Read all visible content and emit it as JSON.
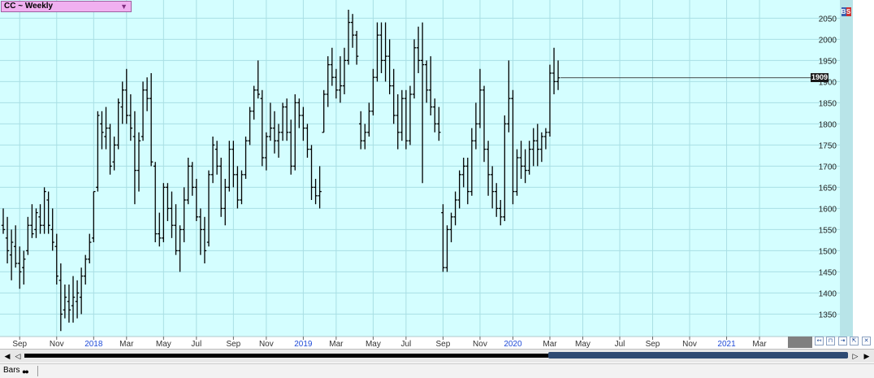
{
  "window": {
    "symbol_label": "CC ~ Weekly",
    "bs_b": "B",
    "bs_s": "S",
    "last_price": "1909",
    "status_label": "Bars"
  },
  "colors": {
    "plot_bg": "#d4feff",
    "grid": "#a9dfe4",
    "bars": "#000000",
    "year_label": "#1f4bd8",
    "month_label": "#333333",
    "price_strip": "#b8e4e8"
  },
  "chart_data": {
    "type": "ohlc",
    "title": "CC ~ Weekly",
    "y_ticks": [
      1350,
      1400,
      1450,
      1500,
      1550,
      1600,
      1650,
      1700,
      1750,
      1800,
      1850,
      1900,
      1950,
      2000,
      2050
    ],
    "ylim": [
      1297,
      2093
    ],
    "grid": true,
    "x_labels": [
      {
        "text": "Sep",
        "year": false,
        "bar": 4
      },
      {
        "text": "Nov",
        "year": false,
        "bar": 13
      },
      {
        "text": "2018",
        "year": true,
        "bar": 22
      },
      {
        "text": "Mar",
        "year": false,
        "bar": 30
      },
      {
        "text": "May",
        "year": false,
        "bar": 39
      },
      {
        "text": "Jul",
        "year": false,
        "bar": 47
      },
      {
        "text": "Sep",
        "year": false,
        "bar": 56
      },
      {
        "text": "Nov",
        "year": false,
        "bar": 64
      },
      {
        "text": "2019",
        "year": true,
        "bar": 73
      },
      {
        "text": "Mar",
        "year": false,
        "bar": 81
      },
      {
        "text": "May",
        "year": false,
        "bar": 90
      },
      {
        "text": "Jul",
        "year": false,
        "bar": 98
      },
      {
        "text": "Sep",
        "year": false,
        "bar": 107
      },
      {
        "text": "Nov",
        "year": false,
        "bar": 116
      },
      {
        "text": "2020",
        "year": true,
        "bar": 124
      },
      {
        "text": "Mar",
        "year": false,
        "bar": 133
      },
      {
        "text": "May",
        "year": false,
        "bar": 141
      },
      {
        "text": "Jul",
        "year": false,
        "bar": 150
      },
      {
        "text": "Sep",
        "year": false,
        "bar": 158
      },
      {
        "text": "Nov",
        "year": false,
        "bar": 167
      },
      {
        "text": "2021",
        "year": true,
        "bar": 176
      },
      {
        "text": "Mar",
        "year": false,
        "bar": 184
      }
    ],
    "bars": [
      [
        1560,
        1600,
        1540,
        1550
      ],
      [
        1530,
        1580,
        1470,
        1500
      ],
      [
        1490,
        1550,
        1430,
        1520
      ],
      [
        1510,
        1560,
        1460,
        1470
      ],
      [
        1470,
        1510,
        1410,
        1450
      ],
      [
        1460,
        1500,
        1420,
        1480
      ],
      [
        1500,
        1580,
        1490,
        1560
      ],
      [
        1560,
        1610,
        1530,
        1540
      ],
      [
        1550,
        1600,
        1530,
        1590
      ],
      [
        1580,
        1610,
        1540,
        1560
      ],
      [
        1560,
        1650,
        1540,
        1640
      ],
      [
        1620,
        1640,
        1540,
        1560
      ],
      [
        1550,
        1600,
        1500,
        1520
      ],
      [
        1510,
        1540,
        1420,
        1440
      ],
      [
        1430,
        1470,
        1310,
        1350
      ],
      [
        1360,
        1420,
        1340,
        1390
      ],
      [
        1380,
        1420,
        1330,
        1360
      ],
      [
        1370,
        1440,
        1330,
        1390
      ],
      [
        1380,
        1430,
        1340,
        1400
      ],
      [
        1390,
        1460,
        1350,
        1440
      ],
      [
        1440,
        1490,
        1420,
        1480
      ],
      [
        1480,
        1540,
        1470,
        1520
      ],
      [
        1530,
        1640,
        1520,
        1640
      ],
      [
        1650,
        1830,
        1640,
        1820
      ],
      [
        1800,
        1830,
        1740,
        1780
      ],
      [
        1770,
        1840,
        1740,
        1790
      ],
      [
        1790,
        1800,
        1680,
        1700
      ],
      [
        1710,
        1770,
        1690,
        1750
      ],
      [
        1750,
        1860,
        1740,
        1850
      ],
      [
        1840,
        1900,
        1800,
        1880
      ],
      [
        1880,
        1930,
        1800,
        1820
      ],
      [
        1820,
        1870,
        1760,
        1790
      ],
      [
        1770,
        1830,
        1610,
        1690
      ],
      [
        1690,
        1780,
        1640,
        1760
      ],
      [
        1770,
        1900,
        1760,
        1880
      ],
      [
        1880,
        1910,
        1830,
        1860
      ],
      [
        1860,
        1920,
        1700,
        1710
      ],
      [
        1700,
        1710,
        1520,
        1540
      ],
      [
        1540,
        1590,
        1510,
        1530
      ],
      [
        1530,
        1660,
        1520,
        1650
      ],
      [
        1650,
        1660,
        1570,
        1600
      ],
      [
        1600,
        1640,
        1530,
        1560
      ],
      [
        1560,
        1610,
        1490,
        1500
      ],
      [
        1500,
        1560,
        1450,
        1550
      ],
      [
        1550,
        1650,
        1520,
        1620
      ],
      [
        1620,
        1720,
        1610,
        1700
      ],
      [
        1700,
        1710,
        1630,
        1650
      ],
      [
        1650,
        1670,
        1570,
        1580
      ],
      [
        1580,
        1600,
        1490,
        1550
      ],
      [
        1550,
        1580,
        1470,
        1500
      ],
      [
        1520,
        1690,
        1510,
        1680
      ],
      [
        1680,
        1770,
        1660,
        1750
      ],
      [
        1740,
        1760,
        1680,
        1700
      ],
      [
        1700,
        1720,
        1580,
        1600
      ],
      [
        1600,
        1670,
        1560,
        1650
      ],
      [
        1650,
        1760,
        1640,
        1740
      ],
      [
        1740,
        1760,
        1650,
        1680
      ],
      [
        1680,
        1700,
        1600,
        1620
      ],
      [
        1620,
        1690,
        1610,
        1680
      ],
      [
        1680,
        1770,
        1670,
        1760
      ],
      [
        1760,
        1840,
        1750,
        1830
      ],
      [
        1830,
        1890,
        1810,
        1880
      ],
      [
        1880,
        1950,
        1860,
        1870
      ],
      [
        1860,
        1880,
        1700,
        1720
      ],
      [
        1720,
        1780,
        1690,
        1770
      ],
      [
        1770,
        1850,
        1760,
        1790
      ],
      [
        1790,
        1830,
        1730,
        1760
      ],
      [
        1760,
        1800,
        1720,
        1780
      ],
      [
        1780,
        1850,
        1760,
        1840
      ],
      [
        1840,
        1860,
        1760,
        1780
      ],
      [
        1780,
        1810,
        1680,
        1700
      ],
      [
        1700,
        1870,
        1690,
        1850
      ],
      [
        1850,
        1860,
        1790,
        1820
      ],
      [
        1820,
        1840,
        1760,
        1790
      ],
      [
        1790,
        1800,
        1720,
        1740
      ],
      [
        1740,
        1750,
        1620,
        1650
      ],
      [
        1650,
        1670,
        1610,
        1630
      ],
      [
        1630,
        1700,
        1600,
        1640
      ],
      [
        1780,
        1880,
        1780,
        1870
      ],
      [
        1870,
        1960,
        1840,
        1940
      ],
      [
        1940,
        1980,
        1890,
        1910
      ],
      [
        1910,
        1930,
        1860,
        1880
      ],
      [
        1880,
        1960,
        1850,
        1890
      ],
      [
        1890,
        1980,
        1870,
        1950
      ],
      [
        1950,
        2070,
        1940,
        2040
      ],
      [
        2040,
        2060,
        1980,
        2010
      ],
      [
        2010,
        2020,
        1940,
        1960
      ],
      [
        1800,
        1830,
        1740,
        1760
      ],
      [
        1760,
        1800,
        1740,
        1780
      ],
      [
        1780,
        1850,
        1770,
        1830
      ],
      [
        1830,
        1930,
        1820,
        1910
      ],
      [
        1910,
        2040,
        1900,
        2010
      ],
      [
        2010,
        2040,
        1920,
        1950
      ],
      [
        1950,
        2040,
        1900,
        1960
      ],
      [
        1960,
        2000,
        1870,
        1890
      ],
      [
        1890,
        1930,
        1800,
        1820
      ],
      [
        1820,
        1870,
        1740,
        1780
      ],
      [
        1780,
        1880,
        1760,
        1860
      ],
      [
        1860,
        1880,
        1740,
        1760
      ],
      [
        1760,
        1890,
        1750,
        1870
      ],
      [
        1870,
        2000,
        1860,
        1980
      ],
      [
        1980,
        2030,
        1920,
        1950
      ],
      [
        1950,
        2040,
        1660,
        1940
      ],
      [
        1940,
        1950,
        1850,
        1880
      ],
      [
        1880,
        1960,
        1820,
        1840
      ],
      [
        1840,
        1860,
        1780,
        1800
      ],
      [
        1800,
        1840,
        1760,
        1780
      ],
      [
        1590,
        1610,
        1450,
        1460
      ],
      [
        1460,
        1560,
        1450,
        1550
      ],
      [
        1550,
        1590,
        1520,
        1580
      ],
      [
        1580,
        1640,
        1560,
        1620
      ],
      [
        1620,
        1690,
        1600,
        1680
      ],
      [
        1680,
        1720,
        1650,
        1700
      ],
      [
        1700,
        1720,
        1610,
        1640
      ],
      [
        1640,
        1790,
        1630,
        1760
      ],
      [
        1760,
        1850,
        1740,
        1800
      ],
      [
        1800,
        1930,
        1790,
        1880
      ],
      [
        1880,
        1890,
        1710,
        1740
      ],
      [
        1740,
        1760,
        1630,
        1680
      ],
      [
        1680,
        1700,
        1600,
        1640
      ],
      [
        1640,
        1660,
        1580,
        1600
      ],
      [
        1600,
        1620,
        1560,
        1580
      ],
      [
        1580,
        1820,
        1570,
        1800
      ],
      [
        1800,
        1950,
        1780,
        1860
      ],
      [
        1860,
        1880,
        1610,
        1640
      ],
      [
        1640,
        1740,
        1630,
        1720
      ],
      [
        1720,
        1760,
        1670,
        1700
      ],
      [
        1700,
        1740,
        1660,
        1690
      ],
      [
        1690,
        1760,
        1680,
        1740
      ],
      [
        1740,
        1790,
        1700,
        1760
      ],
      [
        1760,
        1800,
        1700,
        1740
      ],
      [
        1740,
        1780,
        1710,
        1770
      ],
      [
        1770,
        1790,
        1740,
        1780
      ],
      [
        1780,
        1940,
        1770,
        1920
      ],
      [
        1920,
        1980,
        1870,
        1900
      ],
      [
        1900,
        1950,
        1880,
        1909
      ]
    ],
    "gaps_after": [
      75,
      104
    ]
  }
}
